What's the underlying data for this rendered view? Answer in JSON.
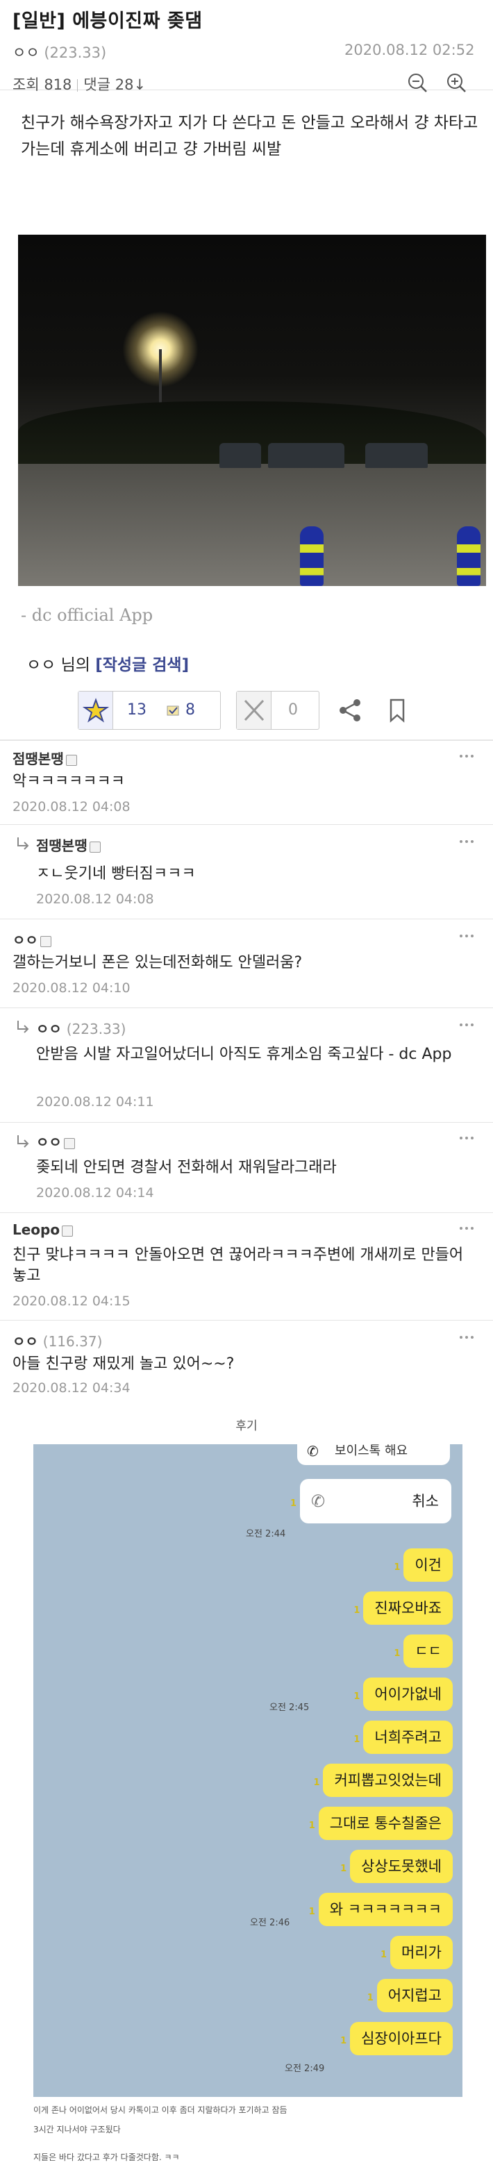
{
  "post": {
    "title": "[일반] 에븡이진짜 좆댐",
    "author": "ㅇㅇ",
    "author_ip": "(223.33)",
    "date": "2020.08.12 02:52",
    "views_label": "조회 818",
    "comments_label": "댓글 28↓",
    "body": "친구가 해수욕장가자고 지가 다 쓴다고 돈 안들고 오라해서 걍 차타고가는데 휴게소에 버리고 걍 가버림 씨발",
    "app_tag": "- dc official App",
    "author_line_name": "ㅇㅇ 님의",
    "author_line_link": "[작성글 검색]"
  },
  "actions": {
    "recommend_count": "13",
    "fixed_recommend_count": "8",
    "nonrecommend_count": "0"
  },
  "comments": [
    {
      "nick": "점땡본땡",
      "ip": "",
      "text": "악ㅋㅋㅋㅋㅋㅋㅋ",
      "time": "2020.08.12 04:08"
    },
    {
      "nick": "점땡본땡",
      "ip": "",
      "text": "ㅈㄴ웃기네 빵터짐ㅋㅋㅋ",
      "time": "2020.08.12 04:08"
    },
    {
      "nick": "ㅇㅇ",
      "ip": "",
      "text": "갤하는거보니 폰은 있는데전화해도 안델러움?",
      "time": "2020.08.12 04:10"
    },
    {
      "nick": "ㅇㅇ",
      "ip": "(223.33)",
      "text": "안받음 시발 자고일어났더니 아직도 휴게소임 죽고싶다 - dc App",
      "time": "2020.08.12 04:11"
    },
    {
      "nick": "ㅇㅇ",
      "ip": "",
      "text": "좆되네 안되면 경찰서 전화해서 재워달라그래라",
      "time": "2020.08.12 04:14"
    },
    {
      "nick": "Leopo",
      "ip": "",
      "text": "친구 맞냐ㅋㅋㅋㅋ 안돌아오면 연 끊어라ㅋㅋㅋ주변에 개새끼로 만들어놓고",
      "time": "2020.08.12 04:15"
    },
    {
      "nick": "ㅇㅇ",
      "ip": "(116.37)",
      "text": "아들 친구랑 재밌게 놀고 있어~~?",
      "time": "2020.08.12 04:34"
    }
  ],
  "after_label": "후기",
  "chat": {
    "call_top": "보이스톡 해요",
    "call_cancel": "취소",
    "times": [
      "오전 2:44",
      "오전 2:45",
      "오전 2:46",
      "오전 2:49"
    ],
    "messages": [
      "이건",
      "진짜오바죠",
      "ㄷㄷ",
      "어이가없네",
      "너희주려고",
      "커피뽑고잇었는데",
      "그대로 통수칠줄은",
      "상상도못했네",
      "와 ㅋㅋㅋㅋㅋㅋㅋ",
      "머리가",
      "어지럽고",
      "심장이아프다"
    ],
    "read_marks": "1"
  },
  "captions": {
    "line1": "이게 존나 어이없어서 당시 카톡이고 이후 좀더 지랄하다가 포기하고 잠듬",
    "line2": "3시간 지나서야 구조됬다",
    "line3": "지들은 바다 갔다고 후가 다줄것다함. ㅋㅋ"
  }
}
